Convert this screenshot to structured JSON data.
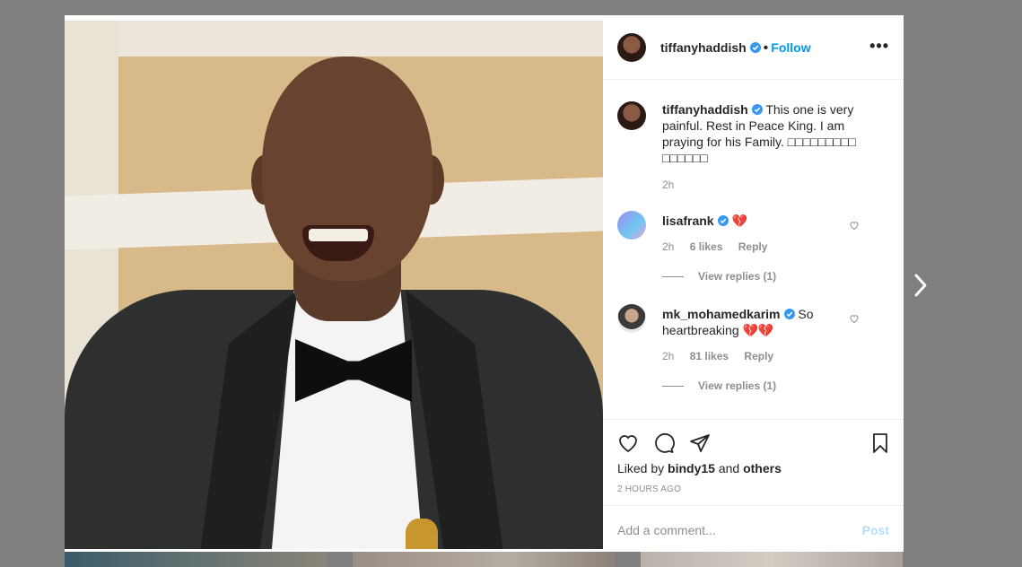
{
  "post": {
    "author": "tiffanyhaddish",
    "follow_label": "Follow",
    "dot": "•",
    "more_label": "•••"
  },
  "caption": {
    "author": "tiffanyhaddish",
    "text": "This one is very painful. Rest in Peace King. I am praying for his Family. □□□□□□□□□ □□□□□□",
    "time": "2h"
  },
  "comments": [
    {
      "author": "lisafrank",
      "text": "💔",
      "time": "2h",
      "likes": "6 likes",
      "reply": "Reply",
      "view_replies": "View replies (1)"
    },
    {
      "author": "mk_mohamedkarim",
      "text": "So heartbreaking 💔💔",
      "time": "2h",
      "likes": "81 likes",
      "reply": "Reply",
      "view_replies": "View replies (1)"
    }
  ],
  "liked_by": {
    "prefix": "Liked by",
    "user": "bindy15",
    "and": "and",
    "others": "others"
  },
  "timestamp": "2 HOURS AGO",
  "add_comment": {
    "placeholder": "Add a comment...",
    "post_label": "Post"
  },
  "colors": {
    "accent": "#0095f6",
    "verified": "#3897f0",
    "heart": "#a11b2a"
  }
}
